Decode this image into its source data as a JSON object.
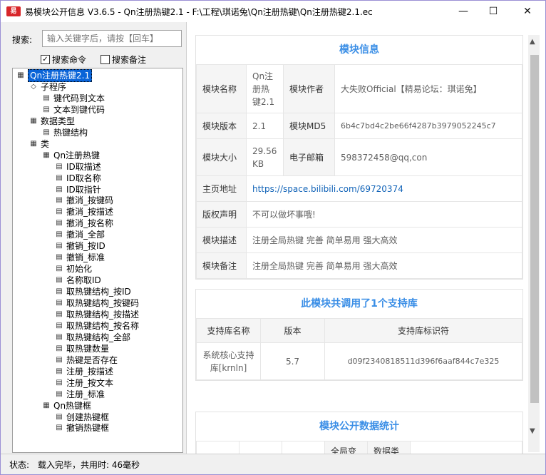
{
  "window": {
    "title": "易模块公开信息 V3.6.5 - Qn注册热键2.1 - F:\\工程\\琪诺兔\\Qn注册热键\\Qn注册热键2.1.ec",
    "icon_label": "易"
  },
  "search": {
    "label": "搜索:",
    "placeholder": "输入关键字后，请按【回车】",
    "opt_command": "搜索命令",
    "opt_note": "搜索备注"
  },
  "tree": [
    {
      "label": "Qn注册热键2.1",
      "level": 0,
      "icon": "module-icon",
      "selected": true
    },
    {
      "label": "子程序",
      "level": 1,
      "icon": "sub-icon"
    },
    {
      "label": "键代码到文本",
      "level": 2,
      "icon": "method-icon"
    },
    {
      "label": "文本到键代码",
      "level": 2,
      "icon": "method-icon"
    },
    {
      "label": "数据类型",
      "level": 1,
      "icon": "datatype-icon"
    },
    {
      "label": "热键结构",
      "level": 2,
      "icon": "method-icon"
    },
    {
      "label": "类",
      "level": 1,
      "icon": "class-icon"
    },
    {
      "label": "Qn注册热键",
      "level": 2,
      "icon": "class-icon"
    },
    {
      "label": "ID取描述",
      "level": 3,
      "icon": "method-icon"
    },
    {
      "label": "ID取名称",
      "level": 3,
      "icon": "method-icon"
    },
    {
      "label": "ID取指针",
      "level": 3,
      "icon": "method-icon"
    },
    {
      "label": "撤消_按键码",
      "level": 3,
      "icon": "method-icon"
    },
    {
      "label": "撤消_按描述",
      "level": 3,
      "icon": "method-icon"
    },
    {
      "label": "撤消_按名称",
      "level": 3,
      "icon": "method-icon"
    },
    {
      "label": "撤消_全部",
      "level": 3,
      "icon": "method-icon"
    },
    {
      "label": "撤销_按ID",
      "level": 3,
      "icon": "method-icon"
    },
    {
      "label": "撤销_标准",
      "level": 3,
      "icon": "method-icon"
    },
    {
      "label": "初始化",
      "level": 3,
      "icon": "method-icon"
    },
    {
      "label": "名称取ID",
      "level": 3,
      "icon": "method-icon"
    },
    {
      "label": "取热键结构_按ID",
      "level": 3,
      "icon": "method-icon"
    },
    {
      "label": "取热键结构_按键码",
      "level": 3,
      "icon": "method-icon"
    },
    {
      "label": "取热键结构_按描述",
      "level": 3,
      "icon": "method-icon"
    },
    {
      "label": "取热键结构_按名称",
      "level": 3,
      "icon": "method-icon"
    },
    {
      "label": "取热键结构_全部",
      "level": 3,
      "icon": "method-icon"
    },
    {
      "label": "取热键数量",
      "level": 3,
      "icon": "method-icon"
    },
    {
      "label": "热键是否存在",
      "level": 3,
      "icon": "method-icon"
    },
    {
      "label": "注册_按描述",
      "level": 3,
      "icon": "method-icon"
    },
    {
      "label": "注册_按文本",
      "level": 3,
      "icon": "method-icon"
    },
    {
      "label": "注册_标准",
      "level": 3,
      "icon": "method-icon"
    },
    {
      "label": "Qn热键框",
      "level": 2,
      "icon": "class-icon"
    },
    {
      "label": "创建热键框",
      "level": 3,
      "icon": "method-icon"
    },
    {
      "label": "撤销热键框",
      "level": 3,
      "icon": "method-icon"
    }
  ],
  "info": {
    "title": "模块信息",
    "name_label": "模块名称",
    "name_value": "Qn注册热键2.1",
    "author_label": "模块作者",
    "author_value": "大失败Official【精易论坛：琪诺兔】",
    "version_label": "模块版本",
    "version_value": "2.1",
    "md5_label": "模块MD5",
    "md5_value": "6b4c7bd4c2be66f4287b3979052245c7",
    "size_label": "模块大小",
    "size_value": "29.56 KB",
    "email_label": "电子邮箱",
    "email_value": "598372458@qq,con",
    "home_label": "主页地址",
    "home_value": "https://space.bilibili.com/69720374",
    "copyright_label": "版权声明",
    "copyright_value": "不可以做坏事哦!",
    "desc_label": "模块描述",
    "desc_value": "注册全局热键 完善 简单易用 强大高效",
    "note_label": "模块备注",
    "note_value": "注册全局热键 完善 简单易用 强大高效"
  },
  "support": {
    "title": "此模块共调用了1个支持库",
    "col_name": "支持库名称",
    "col_version": "版本",
    "col_id": "支持库标识符",
    "rows": [
      {
        "name": "系统核心支持库[krnln]",
        "version": "5.7",
        "id": "d09f2340818511d396f6aaf844c7e325"
      }
    ]
  },
  "stats": {
    "title": "模块公开数据统计",
    "col_a": "全局变",
    "col_b": "数据类"
  },
  "status": {
    "label": "状态:",
    "text": "载入完毕，共用时: 46毫秒"
  }
}
